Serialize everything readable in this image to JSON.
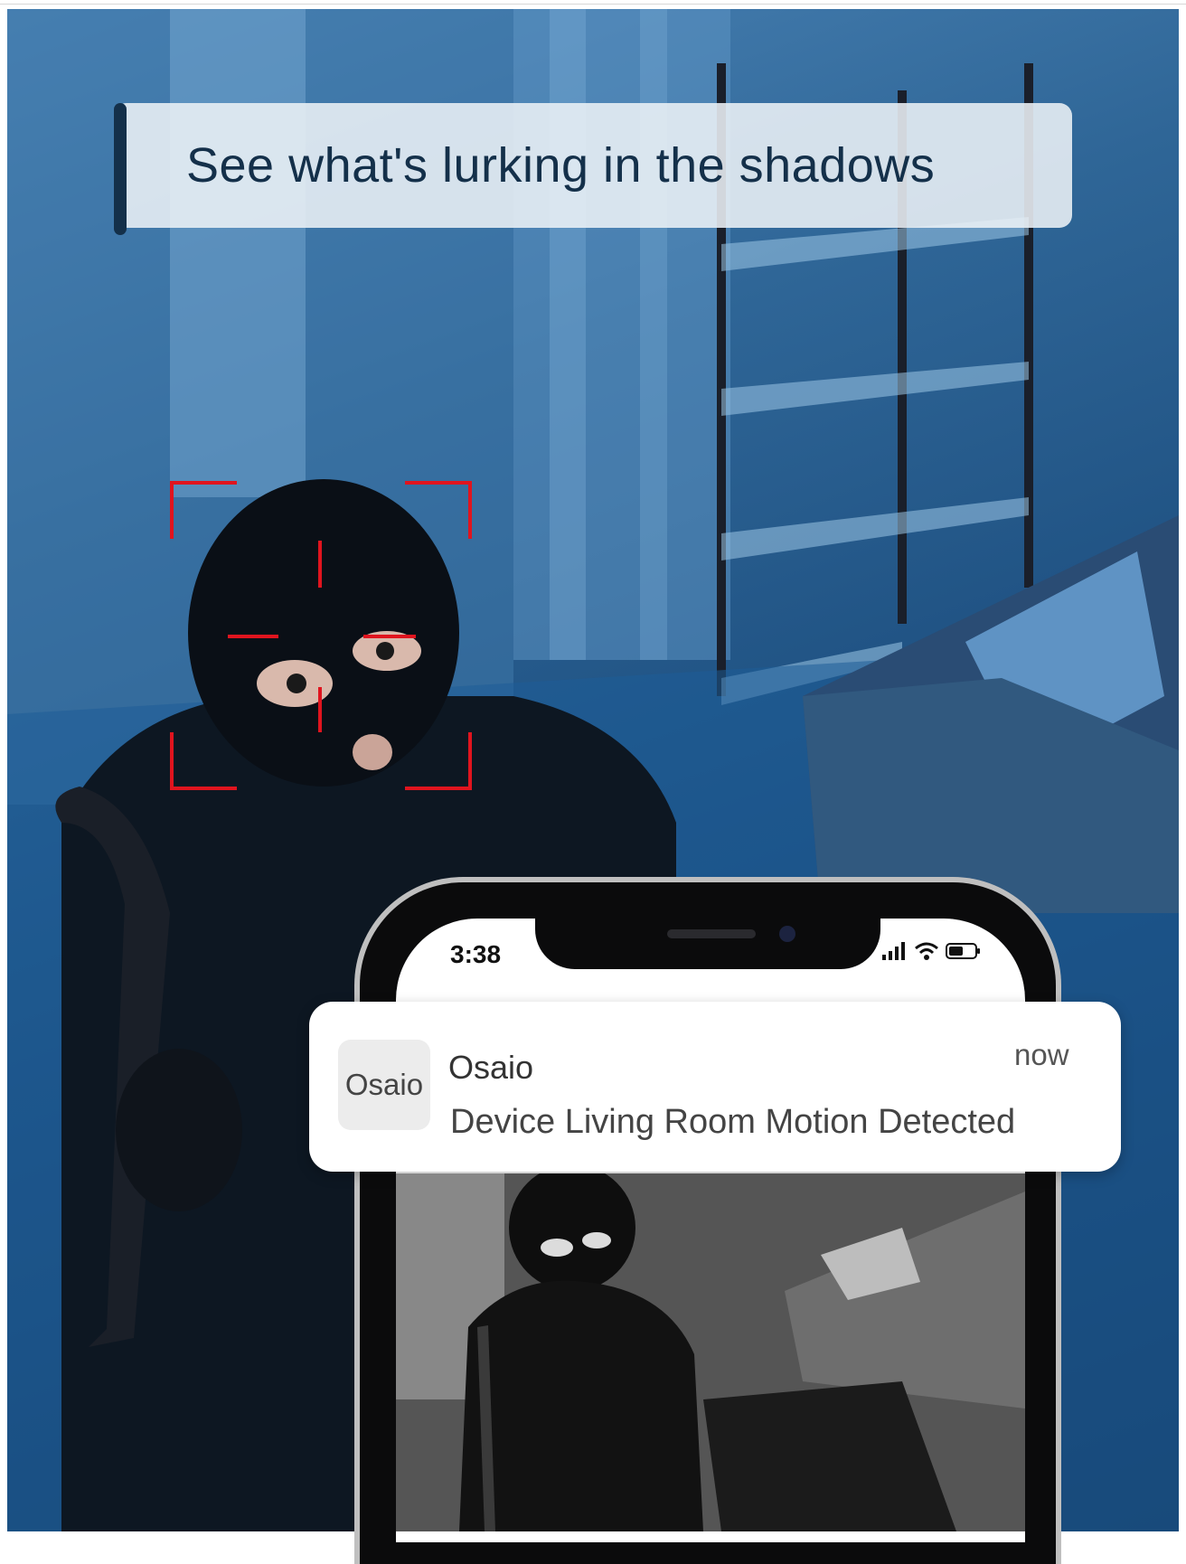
{
  "headline": "See what's lurking in the shadows",
  "phone": {
    "time": "3:38",
    "status_icons": [
      "signal-bars-icon",
      "wifi-icon",
      "battery-icon"
    ]
  },
  "notification": {
    "app_icon_text": "Osaio",
    "app_name": "Osaio",
    "time": "now",
    "message": "Device Living Room Motion Detected"
  },
  "colors": {
    "banner_text": "#14304a",
    "scene_blue": "#1d4f80",
    "detection_red": "#e0141e"
  }
}
